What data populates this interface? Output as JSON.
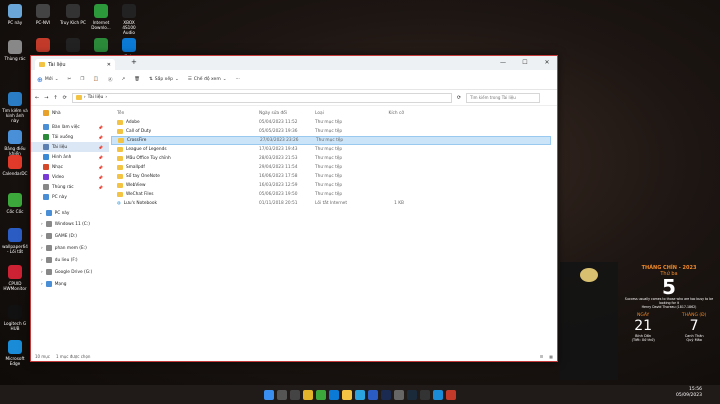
{
  "desktop": {
    "icons": [
      {
        "label": "PC này",
        "color": "#6aa7d8"
      },
      {
        "label": "PC-NVI",
        "color": "#444"
      },
      {
        "label": "Truy Kích PC",
        "color": "#333"
      },
      {
        "label": "Internet Downlo...",
        "color": "#2c9a3a"
      },
      {
        "label": "XBOX 4S100 Audio",
        "color": "#222"
      },
      {
        "label": "Thùng rác",
        "color": "#888"
      },
      {
        "label": "Tìm kiếm và kinh ảnh này",
        "color": "#2a7cc4"
      },
      {
        "label": "Bảng điều khiển",
        "color": "#4a90d9"
      },
      {
        "label": "CalendarDC",
        "color": "#e23a2a"
      },
      {
        "label": "Cốc Cốc",
        "color": "#3ca83c"
      },
      {
        "label": "wallpaper64 - Lối tắt",
        "color": "#2a5cc4"
      },
      {
        "label": "CPUID HWMonitor",
        "color": "#c23"
      },
      {
        "label": "Logitech G HUB",
        "color": "#111"
      },
      {
        "label": "Microsoft Edge",
        "color": "#1a8bd6"
      }
    ],
    "top_icons": [
      "Zalo"
    ]
  },
  "window": {
    "tab_title": "Tài liệu",
    "toolbar": {
      "new": "Mới",
      "sort": "Sắp xếp",
      "view": "Chế độ xem"
    },
    "address": {
      "path": "Tài liệu",
      "search_placeholder": "Tìm kiếm trong Tài liệu"
    },
    "sidebar": {
      "items": [
        {
          "label": "Nhà",
          "color": "#e8a12a"
        },
        {
          "label": "Bàn làm việc",
          "color": "#4a8fd6"
        },
        {
          "label": "Tải xuống",
          "color": "#2a8a3a"
        },
        {
          "label": "Tài liệu",
          "color": "#5a7fb0",
          "selected": true
        },
        {
          "label": "Hình ảnh",
          "color": "#3a8ad6"
        },
        {
          "label": "Nhạc",
          "color": "#d6482a"
        },
        {
          "label": "Video",
          "color": "#7a3ad6"
        },
        {
          "label": "Thùng rác",
          "color": "#888"
        },
        {
          "label": "PC này",
          "color": "#4a8fd6"
        }
      ],
      "pc_header": "PC này",
      "drives": [
        "Windows 11 (C:)",
        "GAME (D:)",
        "phan mem (E:)",
        "du lieu (F:)",
        "Google Drive (G:)"
      ],
      "network": "Mạng"
    },
    "columns": {
      "name": "Tên",
      "date": "Ngày sửa đổi",
      "type": "Loại",
      "size": "Kích cỡ"
    },
    "files": [
      {
        "name": "Adobe",
        "date": "05/04/2023 11:52",
        "type": "Thư mục tệp",
        "size": "",
        "kind": "folder"
      },
      {
        "name": "Call of Duty",
        "date": "05/05/2023 19:36",
        "type": "Thư mục tệp",
        "size": "",
        "kind": "folder"
      },
      {
        "name": "CrossFire",
        "date": "27/03/2023 23:26",
        "type": "Thư mục tệp",
        "size": "",
        "kind": "folder",
        "selected": true
      },
      {
        "name": "League of Legends",
        "date": "17/03/2023 19:43",
        "type": "Thư mục tệp",
        "size": "",
        "kind": "folder"
      },
      {
        "name": "Mẫu Office Tùy chỉnh",
        "date": "28/03/2023 21:53",
        "type": "Thư mục tệp",
        "size": "",
        "kind": "folder"
      },
      {
        "name": "Smallpdf",
        "date": "29/04/2023 11:54",
        "type": "Thư mục tệp",
        "size": "",
        "kind": "folder"
      },
      {
        "name": "Sổ tay OneNote",
        "date": "16/06/2023 17:58",
        "type": "Thư mục tệp",
        "size": "",
        "kind": "folder"
      },
      {
        "name": "WebView",
        "date": "16/03/2023 12:59",
        "type": "Thư mục tệp",
        "size": "",
        "kind": "folder"
      },
      {
        "name": "WeChat Files",
        "date": "05/06/2023 19:50",
        "type": "Thư mục tệp",
        "size": "",
        "kind": "folder"
      },
      {
        "name": "Lưu's Notebook",
        "date": "01/11/2018 20:51",
        "type": "Lối tắt Internet",
        "size": "1 KB",
        "kind": "link"
      }
    ],
    "status": {
      "count": "10 mục",
      "selected": "1 mục được chọn"
    }
  },
  "calendar": {
    "month": "THÁNG CHÍN - 2023",
    "weekday": "Thứ ba",
    "day": "5",
    "quote": "Success usually comes to those who are too busy to be looking for it",
    "quote_author": "Henry David Thoreau (1817-1862)",
    "lunar_day_label": "NGÀY",
    "lunar_month_label": "THÁNG (Đ)",
    "lunar_day": "21",
    "lunar_month": "7",
    "lunar_day_name": "Bính Dần",
    "lunar_year_name": "Canh Thân",
    "lunar_sub": "(Tiết: Xử thử)",
    "lunar_sub2": "Quý Mão"
  },
  "taskbar": {
    "time": "15:56",
    "date": "05/09/2023"
  }
}
